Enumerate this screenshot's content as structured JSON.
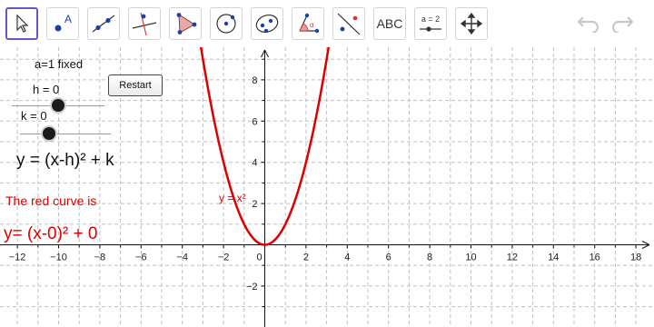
{
  "toolbar": {
    "tools": [
      {
        "name": "move-tool",
        "icon": "cursor-arrow-icon"
      },
      {
        "name": "point-tool",
        "icon": "point-icon",
        "label": "A"
      },
      {
        "name": "line-tool",
        "icon": "line-icon"
      },
      {
        "name": "perpendicular-line-tool",
        "icon": "perpendicular-icon"
      },
      {
        "name": "polygon-tool",
        "icon": "polygon-icon"
      },
      {
        "name": "circle-center-point-tool",
        "icon": "circle-center-icon"
      },
      {
        "name": "ellipse-tool",
        "icon": "ellipse-icon"
      },
      {
        "name": "angle-tool",
        "icon": "angle-icon",
        "label": "α"
      },
      {
        "name": "reflect-tool",
        "icon": "reflect-icon"
      },
      {
        "name": "text-tool",
        "icon": "text-icon",
        "label": "ABC"
      },
      {
        "name": "slider-tool",
        "icon": "slider-icon",
        "label": "a = 2"
      },
      {
        "name": "move-graphics-view-tool",
        "icon": "move-view-icon"
      }
    ],
    "undo_icon": "undo-icon",
    "redo_icon": "redo-icon"
  },
  "panel": {
    "a_fixed": "a=1 fixed",
    "h_label": "h = 0",
    "k_label": "k = 0",
    "general_equation": "y = (x-h)² + k",
    "red_curve_caption": "The red curve is",
    "red_curve_equation": "y= (x-0)² + 0",
    "restart_label": "Restart"
  },
  "graph": {
    "curve_label": "y = x²",
    "x_tick_labels": [
      "−12",
      "−10",
      "−8",
      "−6",
      "−4",
      "−2",
      "0",
      "2",
      "4",
      "6",
      "8",
      "10",
      "12",
      "14",
      "16",
      "18"
    ],
    "y_tick_labels": [
      "8",
      "6",
      "4",
      "2",
      "−2"
    ],
    "curve_color": "#dc0000",
    "grid_color": "#c0c0c0",
    "h": 0,
    "k": 0,
    "a": 1
  }
}
